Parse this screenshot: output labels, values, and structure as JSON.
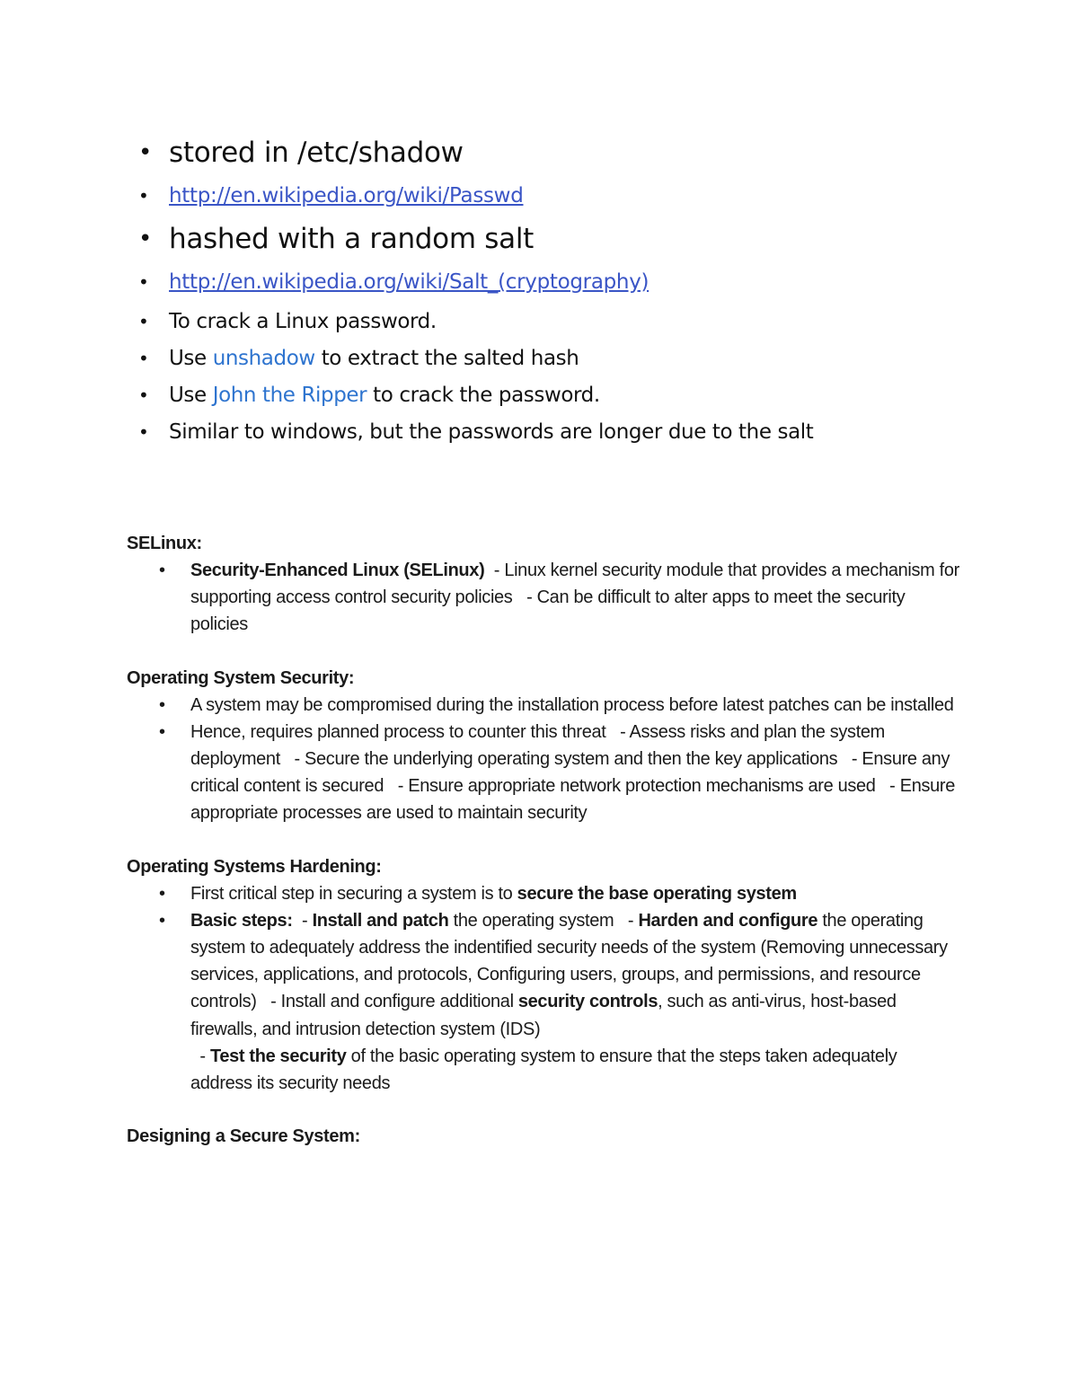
{
  "slide_excerpt": {
    "items": [
      {
        "text": "stored in /etc/shadow"
      },
      {
        "link": "http://en.wikipedia.org/wiki/Passwd"
      },
      {
        "text": "hashed with a random salt"
      },
      {
        "link": "http://en.wikipedia.org/wiki/Salt_(cryptography)"
      },
      {
        "text": "To crack a Linux password."
      },
      {
        "pre": "Use ",
        "tool": "unshadow",
        "post": " to extract the salted hash"
      },
      {
        "pre": "Use ",
        "tool": "John the Ripper",
        "post": " to crack the password."
      },
      {
        "text": "Similar to windows, but the passwords are longer due to the salt"
      }
    ]
  },
  "notes": {
    "selinux": {
      "heading": "SELinux:",
      "items": [
        {
          "bold": "Security-Enhanced Linux (SELinux)",
          "text": "  - Linux kernel security module that provides a mechanism for supporting access control security policies   - Can be difficult to alter apps to meet the security policies"
        }
      ]
    },
    "os_security": {
      "heading": "Operating System Security:",
      "items": [
        {
          "text": "A system may be compromised during the installation process before latest patches can be installed"
        },
        {
          "text": "Hence, requires planned process to counter this threat   - Assess risks and plan the system deployment   - Secure the underlying operating system and then the key applications   - Ensure any critical content is secured   - Ensure appropriate network protection mechanisms are used   - Ensure appropriate processes are used to maintain security"
        }
      ]
    },
    "os_hardening": {
      "heading": "Operating Systems Hardening:",
      "item1": {
        "text": "First critical step in securing a system is to ",
        "bold": "secure the base operating system"
      },
      "item2": {
        "b1": "Basic steps:",
        "t1": "  - ",
        "b2": "Install and patch",
        "t2": " the operating system   - ",
        "b3": "Harden and configure",
        "t3": " the operating system to adequately address the indentified security needs of the system (Removing unnecessary services, applications, and protocols, Configuring users, groups, and permissions, and resource controls)   - Install and configure additional ",
        "b4": "security controls",
        "t4": ", such as anti-virus, host-based firewalls, and intrusion detection system (IDS)",
        "t5": "  - ",
        "b5": "Test the security",
        "t6": " of the basic operating system to ensure that the steps taken adequately address its security needs"
      }
    },
    "designing": {
      "heading": "Designing a Secure System:"
    }
  },
  "bullet_glyph": "•",
  "colors": {
    "link": "#3a55c6",
    "tool_name": "#2e74cf",
    "text": "#111111"
  }
}
